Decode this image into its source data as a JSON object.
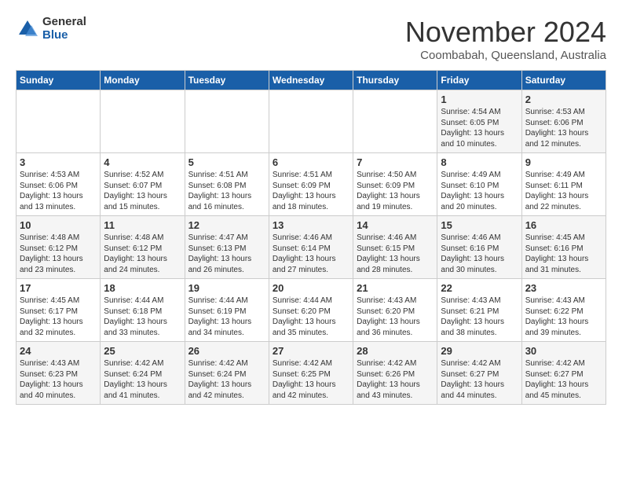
{
  "logo": {
    "general": "General",
    "blue": "Blue"
  },
  "title": "November 2024",
  "location": "Coombabah, Queensland, Australia",
  "days_of_week": [
    "Sunday",
    "Monday",
    "Tuesday",
    "Wednesday",
    "Thursday",
    "Friday",
    "Saturday"
  ],
  "weeks": [
    [
      {
        "day": "",
        "info": ""
      },
      {
        "day": "",
        "info": ""
      },
      {
        "day": "",
        "info": ""
      },
      {
        "day": "",
        "info": ""
      },
      {
        "day": "",
        "info": ""
      },
      {
        "day": "1",
        "info": "Sunrise: 4:54 AM\nSunset: 6:05 PM\nDaylight: 13 hours\nand 10 minutes."
      },
      {
        "day": "2",
        "info": "Sunrise: 4:53 AM\nSunset: 6:06 PM\nDaylight: 13 hours\nand 12 minutes."
      }
    ],
    [
      {
        "day": "3",
        "info": "Sunrise: 4:53 AM\nSunset: 6:06 PM\nDaylight: 13 hours\nand 13 minutes."
      },
      {
        "day": "4",
        "info": "Sunrise: 4:52 AM\nSunset: 6:07 PM\nDaylight: 13 hours\nand 15 minutes."
      },
      {
        "day": "5",
        "info": "Sunrise: 4:51 AM\nSunset: 6:08 PM\nDaylight: 13 hours\nand 16 minutes."
      },
      {
        "day": "6",
        "info": "Sunrise: 4:51 AM\nSunset: 6:09 PM\nDaylight: 13 hours\nand 18 minutes."
      },
      {
        "day": "7",
        "info": "Sunrise: 4:50 AM\nSunset: 6:09 PM\nDaylight: 13 hours\nand 19 minutes."
      },
      {
        "day": "8",
        "info": "Sunrise: 4:49 AM\nSunset: 6:10 PM\nDaylight: 13 hours\nand 20 minutes."
      },
      {
        "day": "9",
        "info": "Sunrise: 4:49 AM\nSunset: 6:11 PM\nDaylight: 13 hours\nand 22 minutes."
      }
    ],
    [
      {
        "day": "10",
        "info": "Sunrise: 4:48 AM\nSunset: 6:12 PM\nDaylight: 13 hours\nand 23 minutes."
      },
      {
        "day": "11",
        "info": "Sunrise: 4:48 AM\nSunset: 6:12 PM\nDaylight: 13 hours\nand 24 minutes."
      },
      {
        "day": "12",
        "info": "Sunrise: 4:47 AM\nSunset: 6:13 PM\nDaylight: 13 hours\nand 26 minutes."
      },
      {
        "day": "13",
        "info": "Sunrise: 4:46 AM\nSunset: 6:14 PM\nDaylight: 13 hours\nand 27 minutes."
      },
      {
        "day": "14",
        "info": "Sunrise: 4:46 AM\nSunset: 6:15 PM\nDaylight: 13 hours\nand 28 minutes."
      },
      {
        "day": "15",
        "info": "Sunrise: 4:46 AM\nSunset: 6:16 PM\nDaylight: 13 hours\nand 30 minutes."
      },
      {
        "day": "16",
        "info": "Sunrise: 4:45 AM\nSunset: 6:16 PM\nDaylight: 13 hours\nand 31 minutes."
      }
    ],
    [
      {
        "day": "17",
        "info": "Sunrise: 4:45 AM\nSunset: 6:17 PM\nDaylight: 13 hours\nand 32 minutes."
      },
      {
        "day": "18",
        "info": "Sunrise: 4:44 AM\nSunset: 6:18 PM\nDaylight: 13 hours\nand 33 minutes."
      },
      {
        "day": "19",
        "info": "Sunrise: 4:44 AM\nSunset: 6:19 PM\nDaylight: 13 hours\nand 34 minutes."
      },
      {
        "day": "20",
        "info": "Sunrise: 4:44 AM\nSunset: 6:20 PM\nDaylight: 13 hours\nand 35 minutes."
      },
      {
        "day": "21",
        "info": "Sunrise: 4:43 AM\nSunset: 6:20 PM\nDaylight: 13 hours\nand 36 minutes."
      },
      {
        "day": "22",
        "info": "Sunrise: 4:43 AM\nSunset: 6:21 PM\nDaylight: 13 hours\nand 38 minutes."
      },
      {
        "day": "23",
        "info": "Sunrise: 4:43 AM\nSunset: 6:22 PM\nDaylight: 13 hours\nand 39 minutes."
      }
    ],
    [
      {
        "day": "24",
        "info": "Sunrise: 4:43 AM\nSunset: 6:23 PM\nDaylight: 13 hours\nand 40 minutes."
      },
      {
        "day": "25",
        "info": "Sunrise: 4:42 AM\nSunset: 6:24 PM\nDaylight: 13 hours\nand 41 minutes."
      },
      {
        "day": "26",
        "info": "Sunrise: 4:42 AM\nSunset: 6:24 PM\nDaylight: 13 hours\nand 42 minutes."
      },
      {
        "day": "27",
        "info": "Sunrise: 4:42 AM\nSunset: 6:25 PM\nDaylight: 13 hours\nand 42 minutes."
      },
      {
        "day": "28",
        "info": "Sunrise: 4:42 AM\nSunset: 6:26 PM\nDaylight: 13 hours\nand 43 minutes."
      },
      {
        "day": "29",
        "info": "Sunrise: 4:42 AM\nSunset: 6:27 PM\nDaylight: 13 hours\nand 44 minutes."
      },
      {
        "day": "30",
        "info": "Sunrise: 4:42 AM\nSunset: 6:27 PM\nDaylight: 13 hours\nand 45 minutes."
      }
    ]
  ]
}
